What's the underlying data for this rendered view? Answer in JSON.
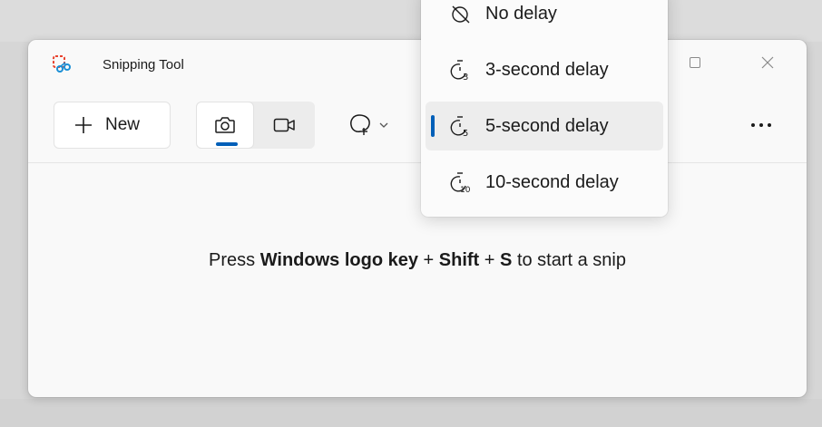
{
  "window": {
    "title": "Snipping Tool",
    "controls": [
      "maximize",
      "close"
    ]
  },
  "toolbar": {
    "new_label": "New",
    "modes": [
      {
        "name": "snip",
        "icon": "camera-icon",
        "selected": true
      },
      {
        "name": "record",
        "icon": "video-camera-icon",
        "selected": false
      }
    ],
    "shape_icon": "freeform-shape-icon",
    "more_icon": "more-icon"
  },
  "main": {
    "hint_prefix": "Press",
    "hint_key1": "Windows logo key",
    "hint_plus1": "+",
    "hint_key2": "Shift",
    "hint_plus2": "+",
    "hint_key3": "S",
    "hint_suffix": "to start a snip"
  },
  "delay_menu": {
    "items": [
      {
        "label": "No delay",
        "icon": "no-delay-timer-icon",
        "selected": false
      },
      {
        "label": "3-second delay",
        "icon": "timer-3-icon",
        "selected": false
      },
      {
        "label": "5-second delay",
        "icon": "timer-5-icon",
        "selected": true
      },
      {
        "label": "10-second delay",
        "icon": "timer-10-icon",
        "selected": false
      }
    ]
  },
  "colors": {
    "accent": "#005fb8",
    "window_bg": "#f9f9f9",
    "text": "#1b1b1b"
  }
}
